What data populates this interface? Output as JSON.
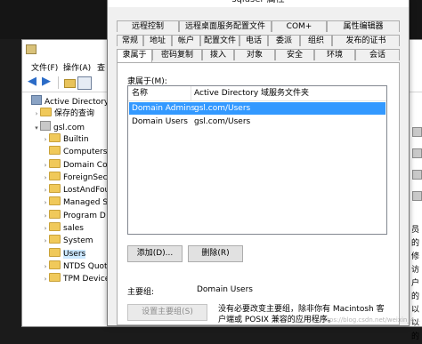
{
  "mmc": {
    "menu": [
      "文件(F)",
      "操作(A)",
      "查"
    ],
    "tree": [
      {
        "label": "Active Directory 用",
        "level": 0,
        "expander": "",
        "icon": "ad"
      },
      {
        "label": "保存的查询",
        "level": 1,
        "expander": ">",
        "icon": "folder"
      },
      {
        "label": "gsl.com",
        "level": 1,
        "expander": "v",
        "icon": "domain"
      },
      {
        "label": "Builtin",
        "level": 2,
        "expander": ">",
        "icon": "folder"
      },
      {
        "label": "Computers",
        "level": 2,
        "expander": "",
        "icon": "folder"
      },
      {
        "label": "Domain Co",
        "level": 2,
        "expander": ">",
        "icon": "folder"
      },
      {
        "label": "ForeignSecu",
        "level": 2,
        "expander": ">",
        "icon": "folder"
      },
      {
        "label": "LostAndFou",
        "level": 2,
        "expander": ">",
        "icon": "folder"
      },
      {
        "label": "Managed S",
        "level": 2,
        "expander": ">",
        "icon": "folder"
      },
      {
        "label": "Program D",
        "level": 2,
        "expander": ">",
        "icon": "folder"
      },
      {
        "label": "sales",
        "level": 2,
        "expander": ">",
        "icon": "folder"
      },
      {
        "label": "System",
        "level": 2,
        "expander": ">",
        "icon": "folder"
      },
      {
        "label": "Users",
        "level": 2,
        "expander": "",
        "icon": "folder",
        "selected": true
      },
      {
        "label": "NTDS Quot",
        "level": 2,
        "expander": ">",
        "icon": "folder"
      },
      {
        "label": "TPM Device",
        "level": 2,
        "expander": ">",
        "icon": "folder"
      }
    ],
    "edge_chars": [
      "员",
      "的",
      "修",
      "访",
      "户",
      "的",
      "以",
      "以",
      "的"
    ]
  },
  "dialog": {
    "title": "sqluser 属性",
    "tabs_row1": [
      "远程控制",
      "远程桌面服务配置文件",
      "COM+",
      "属性编辑器"
    ],
    "tabs_row2": [
      "常规",
      "地址",
      "帐户",
      "配置文件",
      "电话",
      "委派",
      "组织",
      "发布的证书"
    ],
    "tabs_row3": [
      "隶属于",
      "密码复制",
      "拨入",
      "对象",
      "安全",
      "环境",
      "会话"
    ],
    "memberof_label": "隶属于(M):",
    "columns": [
      "名称",
      "Active Directory 域服务文件夹"
    ],
    "rows": [
      {
        "name": "Domain Admins",
        "folder": "gsl.com/Users",
        "selected": true
      },
      {
        "name": "Domain Users",
        "folder": "gsl.com/Users",
        "selected": false
      }
    ],
    "add_button": "添加(D)...",
    "remove_button": "删除(R)",
    "primary_group_label": "主要组:",
    "primary_group_value": "Domain Users",
    "set_primary_button": "设置主要组(S)",
    "primary_note": "没有必要改变主要组，除非你有 Macintosh 客户端或 POSIX 兼容的应用程序。"
  },
  "watermark": "https://blog.csdn.net/weixin_4..."
}
